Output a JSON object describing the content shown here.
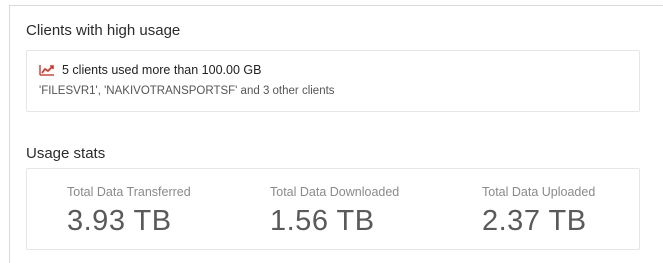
{
  "high_usage": {
    "title": "Clients with high usage",
    "headline": "5 clients used more than 100.00 GB",
    "detail": "'FILESVR1', 'NAKIVOTRANSPORTSF' and 3 other clients",
    "icon": "trend-up-icon",
    "icon_color": "#d9352a"
  },
  "usage_stats": {
    "title": "Usage stats",
    "items": [
      {
        "label": "Total Data Transferred",
        "value": "3.93 TB"
      },
      {
        "label": "Total Data Downloaded",
        "value": "1.56 TB"
      },
      {
        "label": "Total Data Uploaded",
        "value": "2.37 TB"
      }
    ]
  }
}
